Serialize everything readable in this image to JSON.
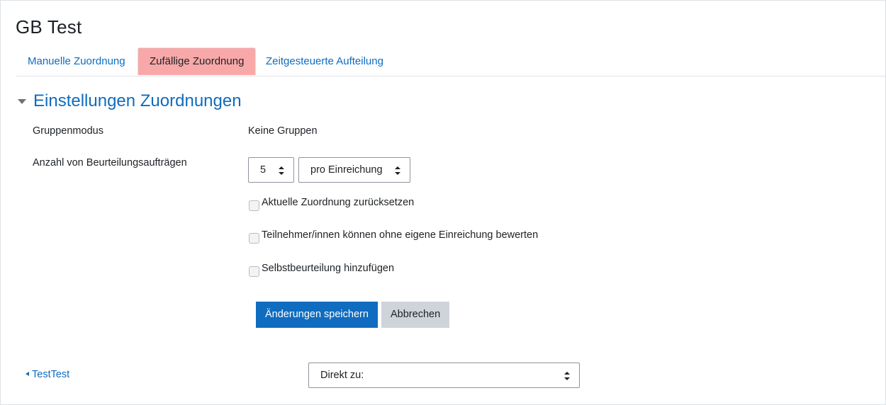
{
  "page": {
    "title": "GB Test"
  },
  "tabs": [
    {
      "label": "Manuelle Zuordnung",
      "active": false
    },
    {
      "label": "Zufällige Zuordnung",
      "active": true
    },
    {
      "label": "Zeitgesteuerte Aufteilung",
      "active": false
    }
  ],
  "section": {
    "title": "Einstellungen Zuordnungen",
    "expanded": true
  },
  "form": {
    "gruppenmodus": {
      "label": "Gruppenmodus",
      "value": "Keine Gruppen"
    },
    "anzahl": {
      "label": "Anzahl von Beurteilungsaufträgen",
      "count_value": "5",
      "per_value": "pro Einreichung"
    },
    "checkboxes": [
      {
        "label": "Aktuelle Zuordnung zurücksetzen",
        "checked": false
      },
      {
        "label": "Teilnehmer/innen können ohne eigene Einreichung bewerten",
        "checked": false
      },
      {
        "label": "Selbstbeurteilung hinzufügen",
        "checked": false
      }
    ],
    "save_label": "Änderungen speichern",
    "cancel_label": "Abbrechen"
  },
  "footer": {
    "prev_link": "TestTest",
    "jump_select": "Direkt zu:"
  },
  "colors": {
    "link": "#0f6cbf",
    "active_tab_bg": "#f8a8a8",
    "primary_button": "#0f6cbf",
    "secondary_button": "#ced4da"
  },
  "icons": {
    "section_toggle": "caret-down-icon",
    "select_arrows": "sort-updown-icon",
    "prev": "triangle-left-icon"
  }
}
